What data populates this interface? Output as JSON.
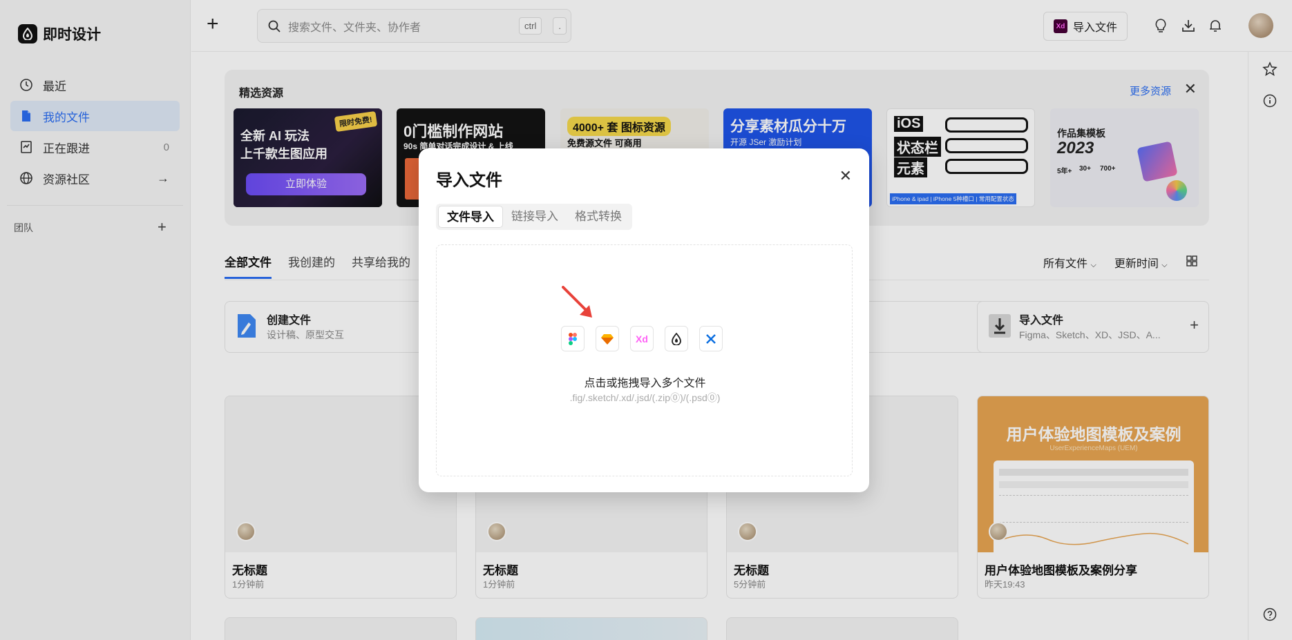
{
  "app": {
    "name": "即时设计"
  },
  "sidebar": {
    "items": [
      {
        "label": "最近",
        "icon": "clock-icon",
        "right": ""
      },
      {
        "label": "我的文件",
        "icon": "file-icon",
        "right": ""
      },
      {
        "label": "正在跟进",
        "icon": "follow-icon",
        "right": "0"
      },
      {
        "label": "资源社区",
        "icon": "globe-icon",
        "right": "→"
      }
    ],
    "team_label": "团队",
    "team_add": "+"
  },
  "topbar": {
    "add": "+",
    "search_placeholder": "搜索文件、文件夹、协作者",
    "kbd_ctrl": "ctrl",
    "kbd_dot": ".",
    "import_label": "导入文件",
    "xd_badge": "Xd"
  },
  "resources": {
    "title": "精选资源",
    "more": "更多资源",
    "close": "✕",
    "banners": [
      {
        "line1": "全新 AI 玩法",
        "line2": "上千款生图应用",
        "cta": "立即体验",
        "tag": "限时免费!",
        "bg": "#0f0f12"
      },
      {
        "line1": "0门槛制作网站",
        "line2": "90s 简单对话完成设计 & 上线",
        "bg": "#141414"
      },
      {
        "line1": "4000+ 套 图标资源",
        "line2": "免费源文件  可商用",
        "bg": "#f1efe9"
      },
      {
        "line1": "分享素材瓜分十万",
        "line2": "开源 JSer 激励计划",
        "bg": "#1f54e8"
      },
      {
        "line1": "iOS",
        "line2": "状态栏",
        "line3": "元素",
        "foot": "iPhone & ipad | iPhone 5种槽口 | 常用配置状态",
        "bg": "#ffffff"
      },
      {
        "line1": "作品集模板",
        "line2": "2023",
        "stat1": "5年+",
        "stat2": "30+",
        "stat3": "700+",
        "bg": "#eeeef3"
      }
    ]
  },
  "tabs": [
    "全部文件",
    "我创建的",
    "共享给我的"
  ],
  "filters": {
    "all": "所有文件",
    "sort": "更新时间"
  },
  "actions": {
    "create": {
      "title": "创建文件",
      "sub": "设计稿、原型交互"
    },
    "import": {
      "title": "导入文件",
      "sub": "Figma、Sketch、XD、JSD、A..."
    }
  },
  "files": [
    {
      "name": "无标题",
      "time": "1分钟前"
    },
    {
      "name": "无标题",
      "time": "1分钟前"
    },
    {
      "name": "无标题",
      "time": "5分钟前"
    },
    {
      "name": "用户体验地图模板及案例分享",
      "time": "昨天19:43",
      "thumb_title": "用户体验地图模板及案例",
      "thumb_sub": "UserExperienceMaps (UEM)"
    }
  ],
  "modal": {
    "title": "导入文件",
    "close": "✕",
    "tabs": [
      "文件导入",
      "链接导入",
      "格式转换"
    ],
    "drop_text": "点击或拖拽导入多个文件",
    "drop_sub": ".fig/.sketch/.xd/.jsd/(.zip⓪)/(.psd⓪)",
    "formats": [
      "figma-icon",
      "sketch-icon",
      "xd-icon",
      "jsd-icon",
      "axure-icon"
    ],
    "xd_text": "Xd"
  },
  "colors": {
    "accent": "#2b6ef2",
    "arrow": "#e8423a",
    "orange": "#e8a552"
  }
}
